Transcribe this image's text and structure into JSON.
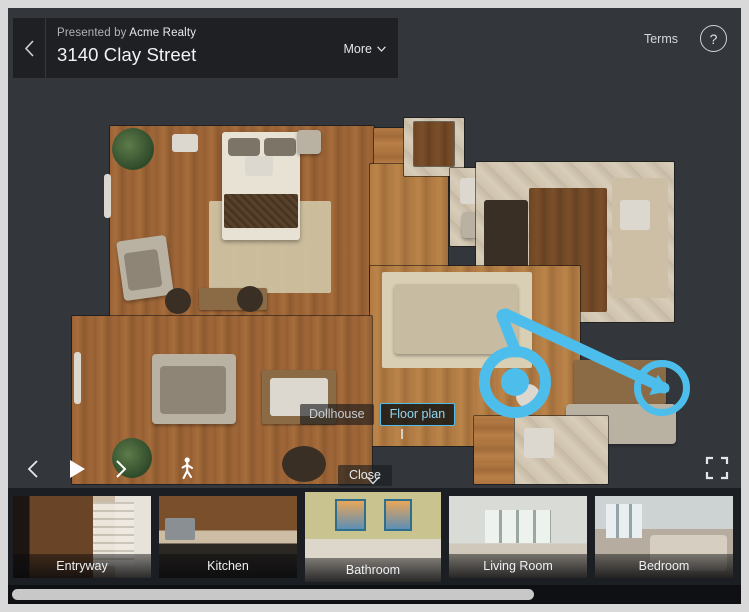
{
  "header": {
    "back_icon": "chevron-left-icon",
    "presented_prefix": "Presented by ",
    "brand": "Acme Realty",
    "address": "3140 Clay Street",
    "more_label": "More",
    "more_icon": "chevron-down-icon"
  },
  "top_right": {
    "terms_label": "Terms",
    "help_label": "?",
    "help_icon": "question-mark-icon"
  },
  "viewer": {
    "mode_chips": [
      {
        "label": "Dollhouse",
        "selected": false,
        "name": "mode-dollhouse"
      },
      {
        "label": "Floor plan",
        "selected": true,
        "name": "mode-floorplan"
      }
    ],
    "close_label": "Close",
    "marker_color": "#4dbeec",
    "position_marker_icon": "position-ring-icon",
    "view_direction_icon": "view-direction-arrow-icon"
  },
  "controls": {
    "prev_icon": "chevron-left-icon",
    "play_icon": "play-icon",
    "next_icon": "chevron-right-icon",
    "walk_icon": "walking-person-icon",
    "fullscreen_icon": "fullscreen-expand-icon",
    "prev_label": "Previous",
    "play_label": "Play",
    "next_label": "Next",
    "walk_label": "Walkthrough",
    "fullscreen_label": "Fullscreen"
  },
  "thumbnails": [
    {
      "label": "Entryway",
      "selected": false,
      "art": "t-entryway"
    },
    {
      "label": "Kitchen",
      "selected": false,
      "art": "t-kitchen"
    },
    {
      "label": "Bathroom",
      "selected": true,
      "art": "t-bathroom"
    },
    {
      "label": "Living Room",
      "selected": false,
      "art": "t-living"
    },
    {
      "label": "Bedroom",
      "selected": false,
      "art": "t-bedroom"
    }
  ],
  "scrollbar": {
    "thumb_percent": 72
  },
  "colors": {
    "panel": "#1e2024",
    "stage": "#33373c",
    "accent": "#4dbeec",
    "strip": "#1b1e22"
  }
}
